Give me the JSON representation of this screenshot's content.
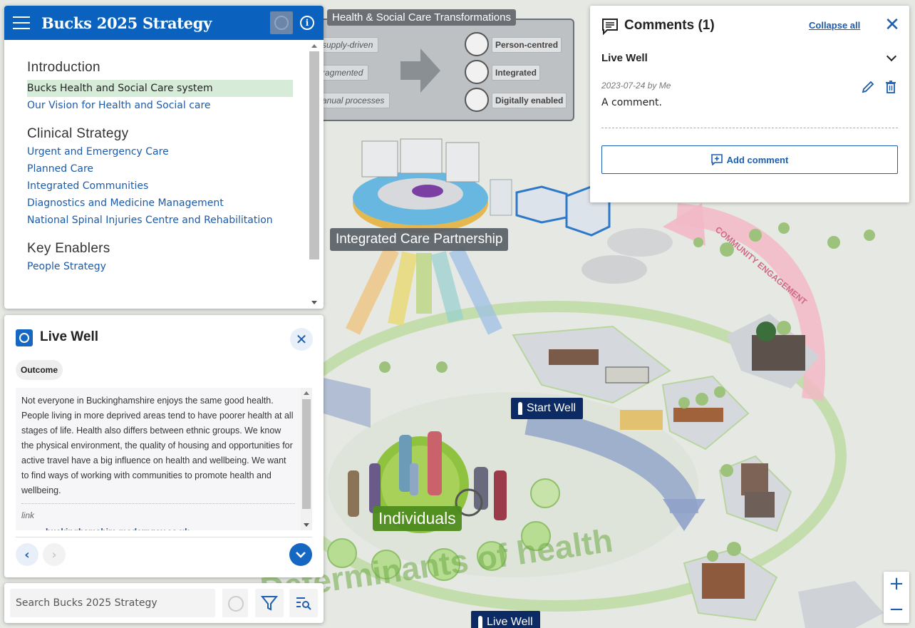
{
  "app": {
    "title": "Bucks 2025 Strategy"
  },
  "toc": {
    "sections": [
      {
        "heading": "Introduction",
        "items": [
          {
            "label": "Bucks Health and Social Care system",
            "active": true
          },
          {
            "label": "Our Vision for Health and Social care",
            "active": false
          }
        ]
      },
      {
        "heading": "Clinical Strategy",
        "items": [
          {
            "label": "Urgent and Emergency Care",
            "active": false
          },
          {
            "label": "Planned Care",
            "active": false
          },
          {
            "label": "Integrated Communities",
            "active": false
          },
          {
            "label": "Diagnostics and Medicine Management",
            "active": false
          },
          {
            "label": "National Spinal Injuries Centre and Rehabilitation",
            "active": false
          }
        ]
      },
      {
        "heading": "Key Enablers",
        "items": [
          {
            "label": "People Strategy",
            "active": false
          }
        ]
      }
    ]
  },
  "feature": {
    "title": "Live Well",
    "badge": "Outcome",
    "description": "Not everyone in Buckinghamshire enjoys the same good health. People living in more deprived areas tend to have poorer health at all stages of life. Health also differs between ethnic groups. We know the physical environment, the quality of housing and opportunities for active travel have a big influence on health and wellbeing. We want to find ways of working with communities to promote health and wellbeing.",
    "link_label": "link",
    "link_text": "buckinghamshire.moderngov.co.uk"
  },
  "search": {
    "placeholder": "Search Bucks 2025 Strategy"
  },
  "comments": {
    "title": "Comments (1)",
    "collapse_label": "Collapse all",
    "item_title": "Live Well",
    "meta": "2023-07-24 by Me",
    "text": "A comment.",
    "add_label": "Add comment"
  },
  "map": {
    "transformations_title": "Health & Social Care Transformations",
    "left_items": [
      "supply-driven",
      "ragmented",
      "anual processes"
    ],
    "right_items": [
      "Person-centred",
      "Integrated",
      "Digitally enabled"
    ],
    "icp_label": "Integrated Care Partnership",
    "individuals_label": "Individuals",
    "start_well_label": "Start Well",
    "live_well_label": "Live Well",
    "community_label": "COMMUNITY ENGAGEMENT",
    "determinants_label": "Determinants of health"
  },
  "colors": {
    "header_blue": "#0a62be",
    "link_blue": "#1d5aa8",
    "active_bg": "#d6ecd9",
    "map_navy": "#0c2a63"
  }
}
